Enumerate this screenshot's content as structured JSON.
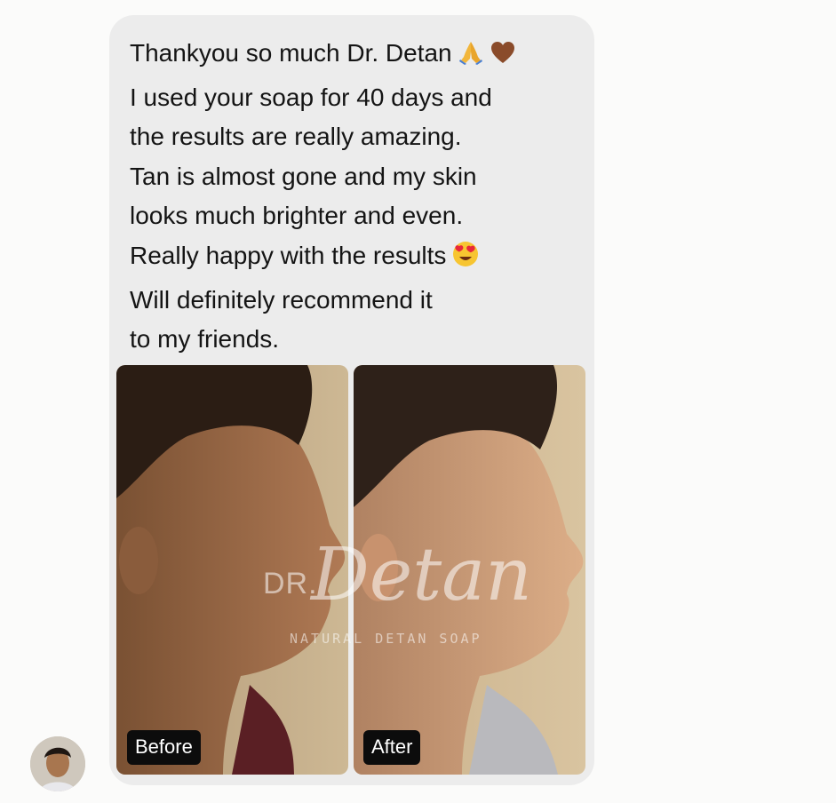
{
  "message": {
    "lines": [
      "Thankyou so much Dr. Detan",
      "I used your soap for 40 days and",
      "the results are really amazing.",
      "Tan is almost gone and my skin",
      "looks much brighter and even.",
      "Really happy with the results",
      "Will definitely recommend it",
      "to my friends."
    ],
    "emojis": [
      "folded-hands-icon",
      "brown-heart-icon",
      "heart-eyes-face-icon"
    ]
  },
  "photos": {
    "before_label": "Before",
    "after_label": "After"
  },
  "watermark": {
    "brand_prefix": "DR.",
    "brand_name": "Detan",
    "tagline": "NATURAL DETAN SOAP"
  },
  "colors": {
    "bubble_bg": "#ececec",
    "label_bg": "#0c0c0c",
    "label_text": "#ffffff",
    "text": "#141414"
  }
}
